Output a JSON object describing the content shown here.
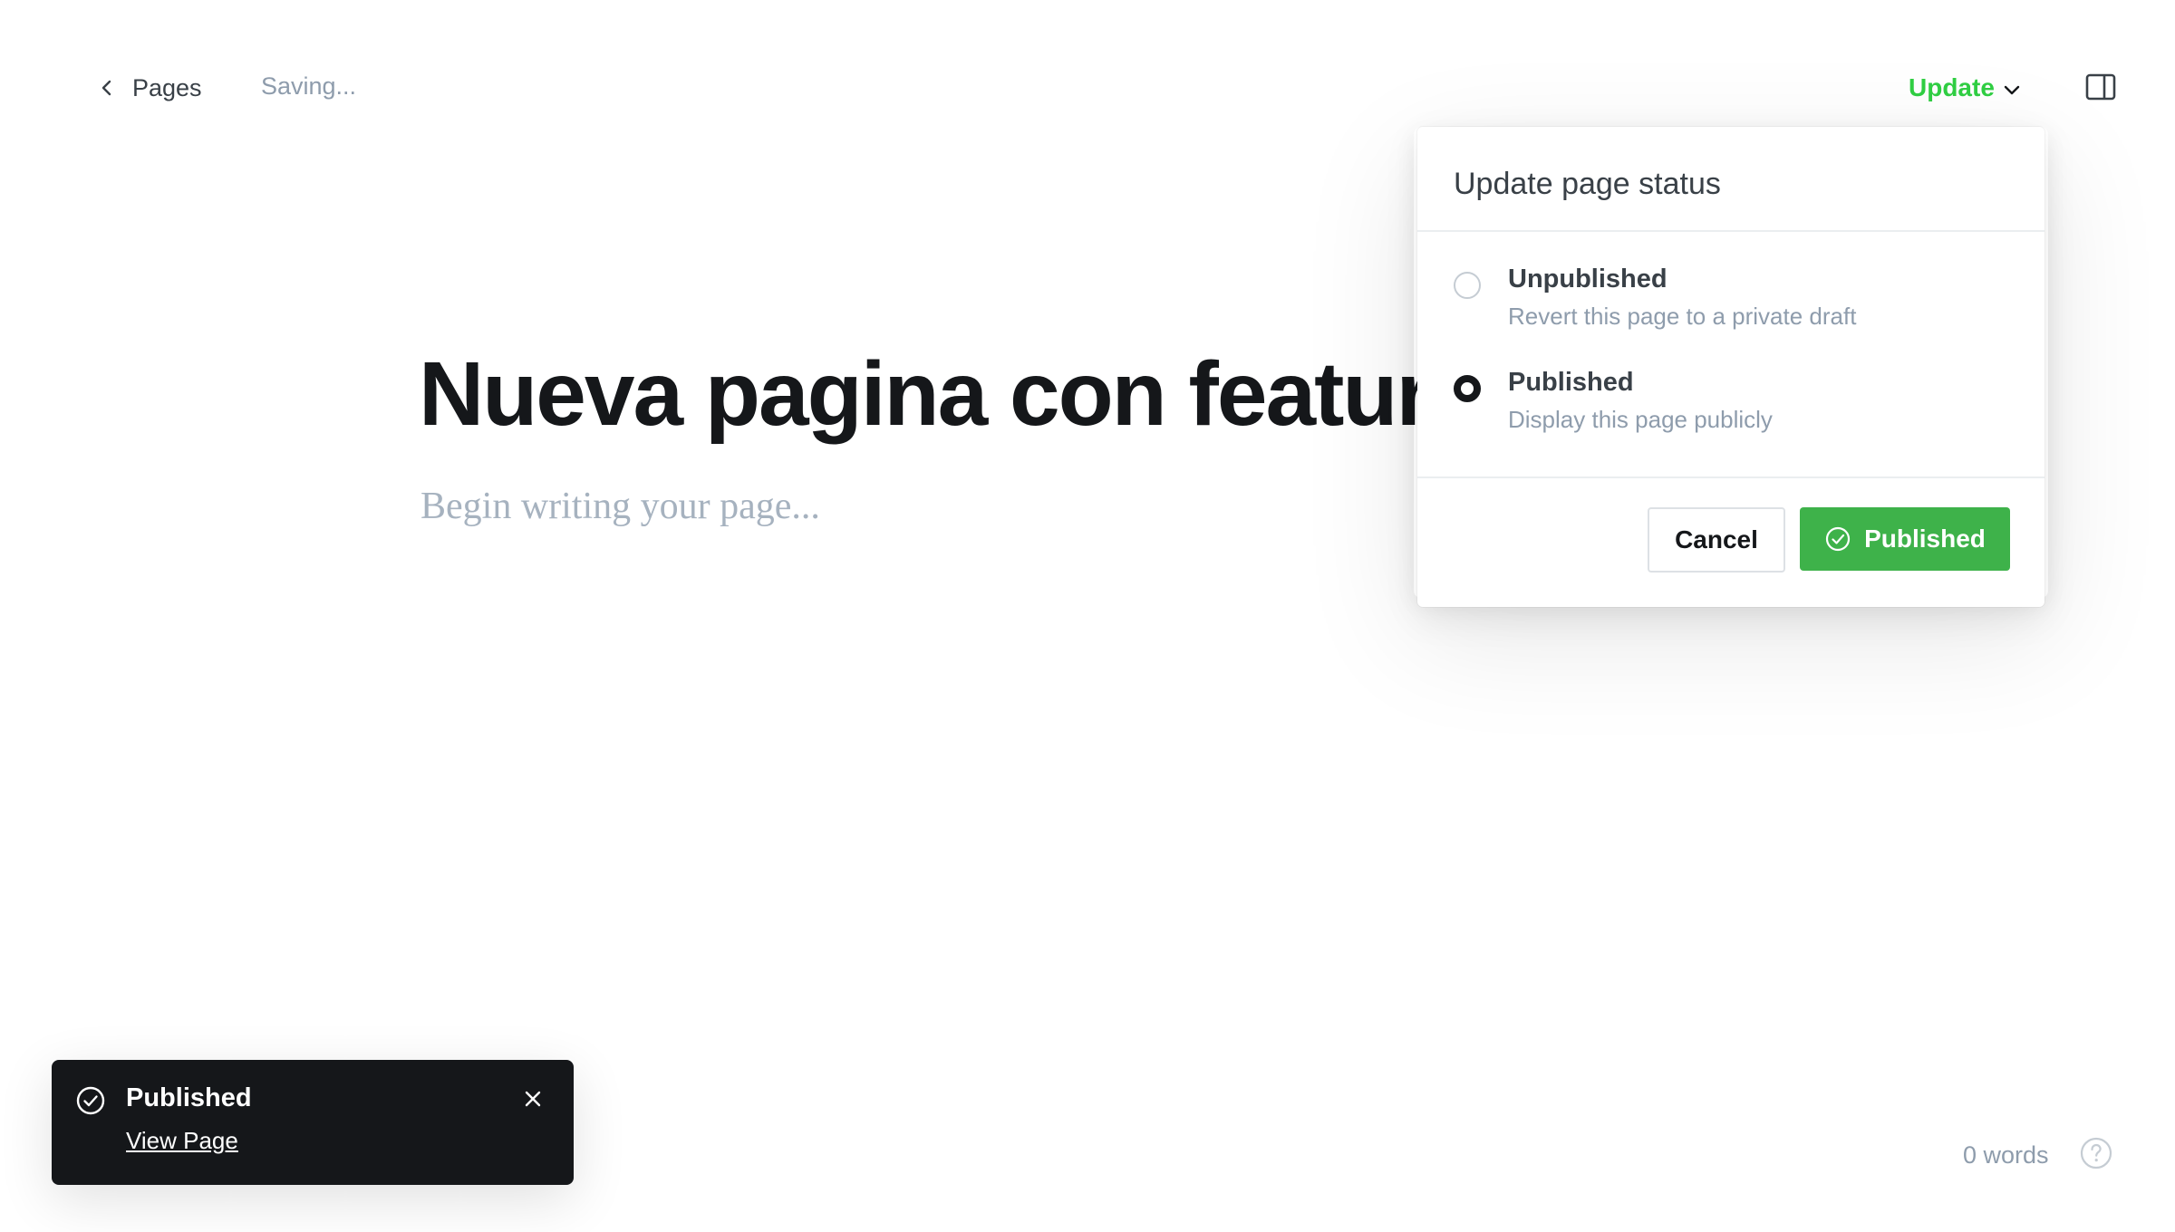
{
  "topbar": {
    "back_label": "Pages",
    "saving_text": "Saving...",
    "update_label": "Update"
  },
  "editor": {
    "title": "Nueva pagina con feature",
    "placeholder": "Begin writing your page..."
  },
  "publish_menu": {
    "header": "Update page status",
    "options": [
      {
        "label": "Unpublished",
        "description": "Revert this page to a private draft",
        "selected": false
      },
      {
        "label": "Published",
        "description": "Display this page publicly",
        "selected": true
      }
    ],
    "cancel_label": "Cancel",
    "confirm_label": "Published"
  },
  "toast": {
    "title": "Published",
    "link_label": "View Page"
  },
  "footer": {
    "word_count": "0 words"
  },
  "icons": {
    "back": "chevron-left-icon",
    "update_caret": "chevron-down-icon",
    "sidebar": "sidebar-toggle-icon",
    "check": "check-circle-icon",
    "close": "close-icon",
    "help": "question-circle-icon"
  },
  "colors": {
    "accent_green": "#30cf43",
    "button_green": "#3eb24a",
    "toast_bg": "#15171a",
    "muted_text": "#8e9cac"
  }
}
